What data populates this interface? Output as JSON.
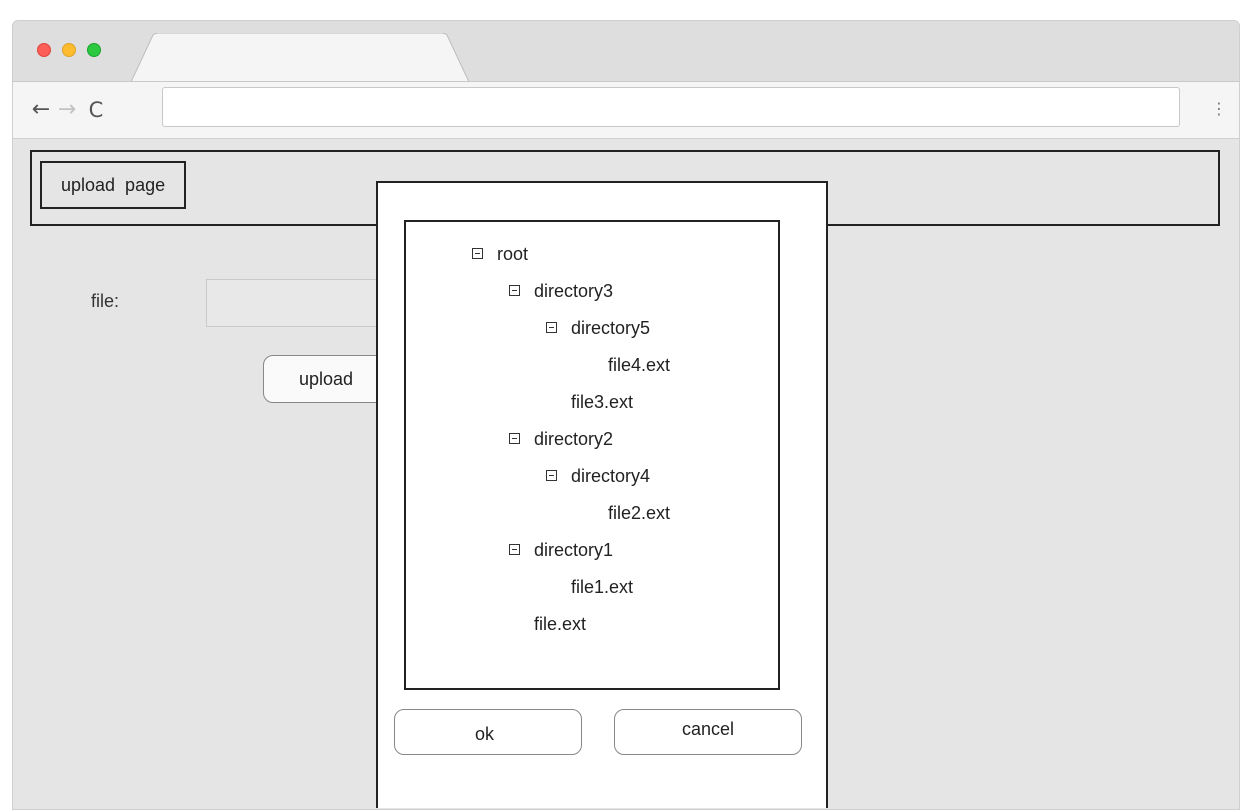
{
  "browser": {
    "back_glyph": "←",
    "forward_glyph": "→",
    "reload_glyph": "C",
    "menu_glyph": "⋮",
    "address_value": "",
    "tab_title": ""
  },
  "page": {
    "title": "upload  page",
    "file_label": "file:",
    "upload_button": "upload"
  },
  "dialog": {
    "tree": [
      {
        "label": "root",
        "expandable": true,
        "level": 0
      },
      {
        "label": "directory3",
        "expandable": true,
        "level": 1
      },
      {
        "label": "directory5",
        "expandable": true,
        "level": 2
      },
      {
        "label": "file4.ext",
        "expandable": false,
        "level": 3
      },
      {
        "label": "file3.ext",
        "expandable": false,
        "level": 2
      },
      {
        "label": "directory2",
        "expandable": true,
        "level": 1
      },
      {
        "label": "directory4",
        "expandable": true,
        "level": 2
      },
      {
        "label": "file2.ext",
        "expandable": false,
        "level": 3
      },
      {
        "label": "directory1",
        "expandable": true,
        "level": 1
      },
      {
        "label": "file1.ext",
        "expandable": false,
        "level": 2
      },
      {
        "label": "file.ext",
        "expandable": false,
        "level": 1
      }
    ],
    "ok_button": "ok",
    "cancel_button": "cancel"
  },
  "colors": {
    "traffic_red": "#fb5f57",
    "traffic_yellow": "#fdbc2e",
    "traffic_green": "#2ac940",
    "page_background": "#e5e5e5"
  }
}
